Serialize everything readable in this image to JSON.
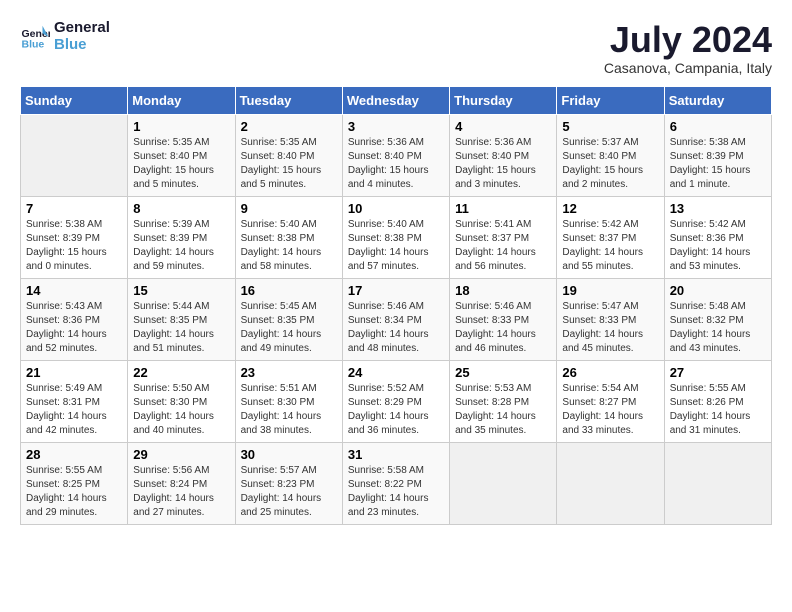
{
  "logo": {
    "line1": "General",
    "line2": "Blue"
  },
  "title": "July 2024",
  "subtitle": "Casanova, Campania, Italy",
  "weekdays": [
    "Sunday",
    "Monday",
    "Tuesday",
    "Wednesday",
    "Thursday",
    "Friday",
    "Saturday"
  ],
  "weeks": [
    [
      {
        "day": "",
        "info": ""
      },
      {
        "day": "1",
        "info": "Sunrise: 5:35 AM\nSunset: 8:40 PM\nDaylight: 15 hours\nand 5 minutes."
      },
      {
        "day": "2",
        "info": "Sunrise: 5:35 AM\nSunset: 8:40 PM\nDaylight: 15 hours\nand 5 minutes."
      },
      {
        "day": "3",
        "info": "Sunrise: 5:36 AM\nSunset: 8:40 PM\nDaylight: 15 hours\nand 4 minutes."
      },
      {
        "day": "4",
        "info": "Sunrise: 5:36 AM\nSunset: 8:40 PM\nDaylight: 15 hours\nand 3 minutes."
      },
      {
        "day": "5",
        "info": "Sunrise: 5:37 AM\nSunset: 8:40 PM\nDaylight: 15 hours\nand 2 minutes."
      },
      {
        "day": "6",
        "info": "Sunrise: 5:38 AM\nSunset: 8:39 PM\nDaylight: 15 hours\nand 1 minute."
      }
    ],
    [
      {
        "day": "7",
        "info": "Sunrise: 5:38 AM\nSunset: 8:39 PM\nDaylight: 15 hours\nand 0 minutes."
      },
      {
        "day": "8",
        "info": "Sunrise: 5:39 AM\nSunset: 8:39 PM\nDaylight: 14 hours\nand 59 minutes."
      },
      {
        "day": "9",
        "info": "Sunrise: 5:40 AM\nSunset: 8:38 PM\nDaylight: 14 hours\nand 58 minutes."
      },
      {
        "day": "10",
        "info": "Sunrise: 5:40 AM\nSunset: 8:38 PM\nDaylight: 14 hours\nand 57 minutes."
      },
      {
        "day": "11",
        "info": "Sunrise: 5:41 AM\nSunset: 8:37 PM\nDaylight: 14 hours\nand 56 minutes."
      },
      {
        "day": "12",
        "info": "Sunrise: 5:42 AM\nSunset: 8:37 PM\nDaylight: 14 hours\nand 55 minutes."
      },
      {
        "day": "13",
        "info": "Sunrise: 5:42 AM\nSunset: 8:36 PM\nDaylight: 14 hours\nand 53 minutes."
      }
    ],
    [
      {
        "day": "14",
        "info": "Sunrise: 5:43 AM\nSunset: 8:36 PM\nDaylight: 14 hours\nand 52 minutes."
      },
      {
        "day": "15",
        "info": "Sunrise: 5:44 AM\nSunset: 8:35 PM\nDaylight: 14 hours\nand 51 minutes."
      },
      {
        "day": "16",
        "info": "Sunrise: 5:45 AM\nSunset: 8:35 PM\nDaylight: 14 hours\nand 49 minutes."
      },
      {
        "day": "17",
        "info": "Sunrise: 5:46 AM\nSunset: 8:34 PM\nDaylight: 14 hours\nand 48 minutes."
      },
      {
        "day": "18",
        "info": "Sunrise: 5:46 AM\nSunset: 8:33 PM\nDaylight: 14 hours\nand 46 minutes."
      },
      {
        "day": "19",
        "info": "Sunrise: 5:47 AM\nSunset: 8:33 PM\nDaylight: 14 hours\nand 45 minutes."
      },
      {
        "day": "20",
        "info": "Sunrise: 5:48 AM\nSunset: 8:32 PM\nDaylight: 14 hours\nand 43 minutes."
      }
    ],
    [
      {
        "day": "21",
        "info": "Sunrise: 5:49 AM\nSunset: 8:31 PM\nDaylight: 14 hours\nand 42 minutes."
      },
      {
        "day": "22",
        "info": "Sunrise: 5:50 AM\nSunset: 8:30 PM\nDaylight: 14 hours\nand 40 minutes."
      },
      {
        "day": "23",
        "info": "Sunrise: 5:51 AM\nSunset: 8:30 PM\nDaylight: 14 hours\nand 38 minutes."
      },
      {
        "day": "24",
        "info": "Sunrise: 5:52 AM\nSunset: 8:29 PM\nDaylight: 14 hours\nand 36 minutes."
      },
      {
        "day": "25",
        "info": "Sunrise: 5:53 AM\nSunset: 8:28 PM\nDaylight: 14 hours\nand 35 minutes."
      },
      {
        "day": "26",
        "info": "Sunrise: 5:54 AM\nSunset: 8:27 PM\nDaylight: 14 hours\nand 33 minutes."
      },
      {
        "day": "27",
        "info": "Sunrise: 5:55 AM\nSunset: 8:26 PM\nDaylight: 14 hours\nand 31 minutes."
      }
    ],
    [
      {
        "day": "28",
        "info": "Sunrise: 5:55 AM\nSunset: 8:25 PM\nDaylight: 14 hours\nand 29 minutes."
      },
      {
        "day": "29",
        "info": "Sunrise: 5:56 AM\nSunset: 8:24 PM\nDaylight: 14 hours\nand 27 minutes."
      },
      {
        "day": "30",
        "info": "Sunrise: 5:57 AM\nSunset: 8:23 PM\nDaylight: 14 hours\nand 25 minutes."
      },
      {
        "day": "31",
        "info": "Sunrise: 5:58 AM\nSunset: 8:22 PM\nDaylight: 14 hours\nand 23 minutes."
      },
      {
        "day": "",
        "info": ""
      },
      {
        "day": "",
        "info": ""
      },
      {
        "day": "",
        "info": ""
      }
    ]
  ]
}
